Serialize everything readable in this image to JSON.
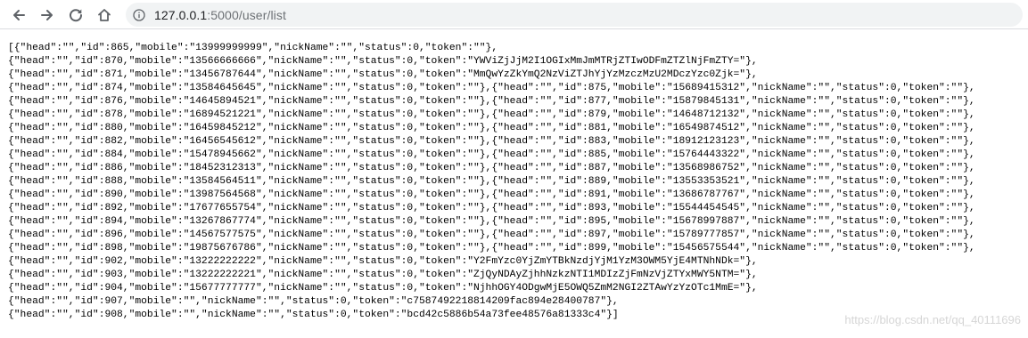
{
  "browser": {
    "address_bar": {
      "url_host": "127.0.0.1",
      "url_path": ":5000/user/list"
    },
    "icons": {
      "back": "back-arrow-icon",
      "forward": "forward-arrow-icon",
      "reload": "reload-icon",
      "home": "home-icon",
      "site_info": "info-icon"
    },
    "colors": {
      "toolbar_icon": "#5f6368",
      "omnibox_bg": "#f1f3f4"
    }
  },
  "page": {
    "lines": [
      "[{\"head\":\"\",\"id\":865,\"mobile\":\"13999999999\",\"nickName\":\"\",\"status\":0,\"token\":\"\"},",
      "{\"head\":\"\",\"id\":870,\"mobile\":\"13566666666\",\"nickName\":\"\",\"status\":0,\"token\":\"YWViZjJjM2I1OGIxMmJmMTRjZTIwODFmZTZlNjFmZTY=\"},",
      "{\"head\":\"\",\"id\":871,\"mobile\":\"13456787644\",\"nickName\":\"\",\"status\":0,\"token\":\"MmQwYzZkYmQ2NzViZTJhYjYzMzczMzU2MDczYzc0Zjk=\"},",
      "{\"head\":\"\",\"id\":874,\"mobile\":\"13584645645\",\"nickName\":\"\",\"status\":0,\"token\":\"\"},{\"head\":\"\",\"id\":875,\"mobile\":\"15689415312\",\"nickName\":\"\",\"status\":0,\"token\":\"\"},",
      "{\"head\":\"\",\"id\":876,\"mobile\":\"14645894521\",\"nickName\":\"\",\"status\":0,\"token\":\"\"},{\"head\":\"\",\"id\":877,\"mobile\":\"15879845131\",\"nickName\":\"\",\"status\":0,\"token\":\"\"},",
      "{\"head\":\"\",\"id\":878,\"mobile\":\"16894521221\",\"nickName\":\"\",\"status\":0,\"token\":\"\"},{\"head\":\"\",\"id\":879,\"mobile\":\"14648712132\",\"nickName\":\"\",\"status\":0,\"token\":\"\"},",
      "{\"head\":\"\",\"id\":880,\"mobile\":\"16459845212\",\"nickName\":\"\",\"status\":0,\"token\":\"\"},{\"head\":\"\",\"id\":881,\"mobile\":\"16549874512\",\"nickName\":\"\",\"status\":0,\"token\":\"\"},",
      "{\"head\":\"\",\"id\":882,\"mobile\":\"16456545612\",\"nickName\":\"\",\"status\":0,\"token\":\"\"},{\"head\":\"\",\"id\":883,\"mobile\":\"18912123123\",\"nickName\":\"\",\"status\":0,\"token\":\"\"},",
      "{\"head\":\"\",\"id\":884,\"mobile\":\"15478945662\",\"nickName\":\"\",\"status\":0,\"token\":\"\"},{\"head\":\"\",\"id\":885,\"mobile\":\"15764443322\",\"nickName\":\"\",\"status\":0,\"token\":\"\"},",
      "{\"head\":\"\",\"id\":886,\"mobile\":\"18452312313\",\"nickName\":\"\",\"status\":0,\"token\":\"\"},{\"head\":\"\",\"id\":887,\"mobile\":\"13568986752\",\"nickName\":\"\",\"status\":0,\"token\":\"\"},",
      "{\"head\":\"\",\"id\":888,\"mobile\":\"13584564511\",\"nickName\":\"\",\"status\":0,\"token\":\"\"},{\"head\":\"\",\"id\":889,\"mobile\":\"13553353521\",\"nickName\":\"\",\"status\":0,\"token\":\"\"},",
      "{\"head\":\"\",\"id\":890,\"mobile\":\"13987564568\",\"nickName\":\"\",\"status\":0,\"token\":\"\"},{\"head\":\"\",\"id\":891,\"mobile\":\"13686787767\",\"nickName\":\"\",\"status\":0,\"token\":\"\"},",
      "{\"head\":\"\",\"id\":892,\"mobile\":\"17677655754\",\"nickName\":\"\",\"status\":0,\"token\":\"\"},{\"head\":\"\",\"id\":893,\"mobile\":\"15544454545\",\"nickName\":\"\",\"status\":0,\"token\":\"\"},",
      "{\"head\":\"\",\"id\":894,\"mobile\":\"13267867774\",\"nickName\":\"\",\"status\":0,\"token\":\"\"},{\"head\":\"\",\"id\":895,\"mobile\":\"15678997887\",\"nickName\":\"\",\"status\":0,\"token\":\"\"},",
      "{\"head\":\"\",\"id\":896,\"mobile\":\"14567577575\",\"nickName\":\"\",\"status\":0,\"token\":\"\"},{\"head\":\"\",\"id\":897,\"mobile\":\"15789777857\",\"nickName\":\"\",\"status\":0,\"token\":\"\"},",
      "{\"head\":\"\",\"id\":898,\"mobile\":\"19875676786\",\"nickName\":\"\",\"status\":0,\"token\":\"\"},{\"head\":\"\",\"id\":899,\"mobile\":\"15456575544\",\"nickName\":\"\",\"status\":0,\"token\":\"\"},",
      "{\"head\":\"\",\"id\":902,\"mobile\":\"13222222222\",\"nickName\":\"\",\"status\":0,\"token\":\"Y2FmYzc0YjZmYTBkNzdjYjM1YzM3OWM5YjE4MTNhNDk=\"},",
      "{\"head\":\"\",\"id\":903,\"mobile\":\"13222222221\",\"nickName\":\"\",\"status\":0,\"token\":\"ZjQyNDAyZjhhNzkzNTI1MDIzZjFmNzVjZTYxMWY5NTM=\"},",
      "{\"head\":\"\",\"id\":904,\"mobile\":\"15677777777\",\"nickName\":\"\",\"status\":0,\"token\":\"NjhhOGY4ODgwMjE5OWQ5ZmM2NGI2ZTAwYzYzOTc1MmE=\"},",
      "{\"head\":\"\",\"id\":907,\"mobile\":\"\",\"nickName\":\"\",\"status\":0,\"token\":\"c7587492218814209fac894e28400787\"},",
      "{\"head\":\"\",\"id\":908,\"mobile\":\"\",\"nickName\":\"\",\"status\":0,\"token\":\"bcd42c5886b54a73fee48576a81333c4\"}]"
    ],
    "watermark": "https://blog.csdn.net/qq_40111696"
  }
}
